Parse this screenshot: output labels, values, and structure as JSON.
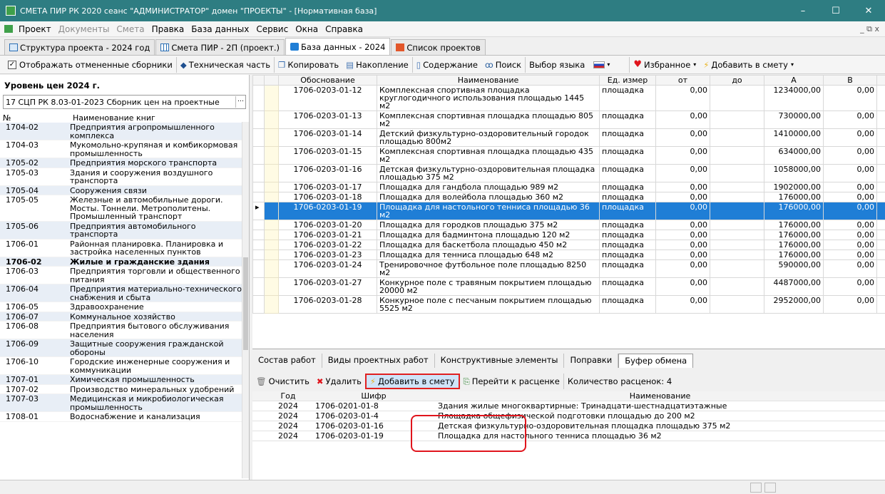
{
  "window": {
    "title": "СМЕТА ПИР РК 2020 сеанс \"АДМИНИСТРАТОР\" домен \"ПРОЕКТЫ\" - [Нормативная база]",
    "controls": [
      "–",
      "☐",
      "✕"
    ]
  },
  "menu": [
    {
      "label": "Проект",
      "enabled": true
    },
    {
      "label": "Документы",
      "enabled": false
    },
    {
      "label": "Смета",
      "enabled": false
    },
    {
      "label": "Правка",
      "enabled": true
    },
    {
      "label": "База данных",
      "enabled": true
    },
    {
      "label": "Сервис",
      "enabled": true
    },
    {
      "label": "Окна",
      "enabled": true
    },
    {
      "label": "Справка",
      "enabled": true
    }
  ],
  "mdi_controls": "_ ⧉ x",
  "tabs": [
    {
      "label": "Структура проекта - 2024 год",
      "active": false
    },
    {
      "label": "Смета ПИР - 2П (проект.)",
      "active": false
    },
    {
      "label": "База данных - 2024",
      "active": true
    },
    {
      "label": "Список проектов",
      "active": false
    }
  ],
  "toolbar": {
    "show_cancelled": "Отображать отмененные сборники",
    "tech_part": "Техническая часть",
    "copy": "Копировать",
    "accumulate": "Накопление",
    "contents": "Содержание",
    "search": "Поиск",
    "language": "Выбор языка",
    "favorites": "Избранное",
    "add_to_estimate": "Добавить в смету"
  },
  "left_panel": {
    "level": "Уровень цен 2024 г.",
    "collection": "17 СЦП РК 8.03-01-2023 Сборник цен на проектные",
    "col_no": "№",
    "col_name": "Наименование книг",
    "rows": [
      {
        "no": "1704-02",
        "name": "Предприятия агропромышленного комплекса"
      },
      {
        "no": "1704-03",
        "name": "Мукомольно-крупяная и комбикормовая промышленность"
      },
      {
        "no": "1705-02",
        "name": "Предприятия морского транспорта"
      },
      {
        "no": "1705-03",
        "name": "Здания и сооружения воздушного транспорта"
      },
      {
        "no": "1705-04",
        "name": "Сооружения связи"
      },
      {
        "no": "1705-05",
        "name": "Железные и автомобильные дороги. Мосты. Тоннели. Метрополитены. Промышленный транспорт"
      },
      {
        "no": "1705-06",
        "name": "Предприятия автомобильного транспорта"
      },
      {
        "no": "1706-01",
        "name": "Районная планировка. Планировка и застройка населенных пунктов"
      },
      {
        "no": "1706-02",
        "name": "Жилые и гражданские здания",
        "bold": true
      },
      {
        "no": "1706-03",
        "name": "Предприятия торговли и общественного питания"
      },
      {
        "no": "1706-04",
        "name": "Предприятия материально-технического снабжения и сбыта"
      },
      {
        "no": "1706-05",
        "name": "Здравоохранение"
      },
      {
        "no": "1706-07",
        "name": "Коммунальное хозяйство"
      },
      {
        "no": "1706-08",
        "name": "Предприятия бытового обслуживания населения"
      },
      {
        "no": "1706-09",
        "name": "Защитные сооружения гражданской обороны"
      },
      {
        "no": "1706-10",
        "name": "Городские инженерные сооружения и коммуникации"
      },
      {
        "no": "1707-01",
        "name": "Химическая промышленность"
      },
      {
        "no": "1707-02",
        "name": "Производство минеральных удобрений"
      },
      {
        "no": "1707-03",
        "name": "Медицинская и микробиологическая промышленность"
      },
      {
        "no": "1708-01",
        "name": "Водоснабжение и канализация"
      }
    ]
  },
  "grid": {
    "headers": [
      "Обоснование",
      "Наименование",
      "Ед. измер",
      "от",
      "до",
      "A",
      "B"
    ],
    "rows": [
      {
        "code": "1706-0203-01-12",
        "name": "Комплексная спортивная площадка круглогодичного использования площадью 1445 м2",
        "unit": "площадка",
        "from": "0,00",
        "to": "",
        "a": "1234000,00",
        "b": "0,00"
      },
      {
        "code": "1706-0203-01-13",
        "name": "Комплексная спортивная площадка площадью 805 м2",
        "unit": "площадка",
        "from": "0,00",
        "to": "",
        "a": "730000,00",
        "b": "0,00"
      },
      {
        "code": "1706-0203-01-14",
        "name": "Детский физкультурно-оздоровительный городок площадью 800м2",
        "unit": "площадка",
        "from": "0,00",
        "to": "",
        "a": "1410000,00",
        "b": "0,00"
      },
      {
        "code": "1706-0203-01-15",
        "name": "Комплексная спортивная площадка площадью 435 м2",
        "unit": "площадка",
        "from": "0,00",
        "to": "",
        "a": "634000,00",
        "b": "0,00"
      },
      {
        "code": "1706-0203-01-16",
        "name": "Детская физкультурно-оздоровительная площадка площадью 375 м2",
        "unit": "площадка",
        "from": "0,00",
        "to": "",
        "a": "1058000,00",
        "b": "0,00"
      },
      {
        "code": "1706-0203-01-17",
        "name": "Площадка для гандбола площадью 989 м2",
        "unit": "площадка",
        "from": "0,00",
        "to": "",
        "a": "1902000,00",
        "b": "0,00"
      },
      {
        "code": "1706-0203-01-18",
        "name": "Площадка для волейбола площадью 360 м2",
        "unit": "площадка",
        "from": "0,00",
        "to": "",
        "a": "176000,00",
        "b": "0,00"
      },
      {
        "code": "1706-0203-01-19",
        "name": "Площадка для настольного тенниса площадью 36 м2",
        "unit": "площадка",
        "from": "0,00",
        "to": "",
        "a": "176000,00",
        "b": "0,00",
        "selected": true
      },
      {
        "code": "1706-0203-01-20",
        "name": "Площадка для городков площадью 375 м2",
        "unit": "площадка",
        "from": "0,00",
        "to": "",
        "a": "176000,00",
        "b": "0,00"
      },
      {
        "code": "1706-0203-01-21",
        "name": "Площадка для бадминтона площадью 120 м2",
        "unit": "площадка",
        "from": "0,00",
        "to": "",
        "a": "176000,00",
        "b": "0,00"
      },
      {
        "code": "1706-0203-01-22",
        "name": "Площадка для баскетбола площадью 450 м2",
        "unit": "площадка",
        "from": "0,00",
        "to": "",
        "a": "176000,00",
        "b": "0,00"
      },
      {
        "code": "1706-0203-01-23",
        "name": "Площадка для тенниса площадью 648 м2",
        "unit": "площадка",
        "from": "0,00",
        "to": "",
        "a": "176000,00",
        "b": "0,00"
      },
      {
        "code": "1706-0203-01-24",
        "name": "Тренировочное футбольное поле площадью 8250 м2",
        "unit": "площадка",
        "from": "0,00",
        "to": "",
        "a": "590000,00",
        "b": "0,00"
      },
      {
        "code": "1706-0203-01-27",
        "name": "Конкурное поле с травяным покрытием площадью 20000 м2",
        "unit": "площадка",
        "from": "0,00",
        "to": "",
        "a": "4487000,00",
        "b": "0,00"
      },
      {
        "code": "1706-0203-01-28",
        "name": "Конкурное поле с песчаным покрытием площадью 5525 м2",
        "unit": "площадка",
        "from": "0,00",
        "to": "",
        "a": "2952000,00",
        "b": "0,00"
      }
    ]
  },
  "bottom_tabs": [
    {
      "label": "Состав работ",
      "active": false
    },
    {
      "label": "Виды проектных работ",
      "active": false
    },
    {
      "label": "Конструктивные элементы",
      "active": false
    },
    {
      "label": "Поправки",
      "active": false
    },
    {
      "label": "Буфер обмена",
      "active": true
    }
  ],
  "clipboard_toolbar": {
    "clear": "Очистить",
    "delete": "Удалить",
    "add": "Добавить в смету",
    "goto": "Перейти к расценке",
    "count": "Количество расценок: 4"
  },
  "clipboard": {
    "headers": [
      "Год",
      "Шифр",
      "Наименование"
    ],
    "rows": [
      {
        "year": "2024",
        "code": "1706-0201-01-8",
        "name": "Здания жилые многоквартирные: Тринадцати-шестнадцатиэтажные"
      },
      {
        "year": "2024",
        "code": "1706-0203-01-4",
        "name": "Площадка общефизической подготовки площадью до 200 м2"
      },
      {
        "year": "2024",
        "code": "1706-0203-01-16",
        "name": "Детская физкультурно-оздоровительная площадка площадью 375 м2"
      },
      {
        "year": "2024",
        "code": "1706-0203-01-19",
        "name": "Площадка для настольного тенниса площадью 36 м2"
      }
    ]
  },
  "colors": {
    "titlebar": "#2e7d82",
    "selection": "#1f7ed6",
    "highlight": "#e0141c"
  }
}
